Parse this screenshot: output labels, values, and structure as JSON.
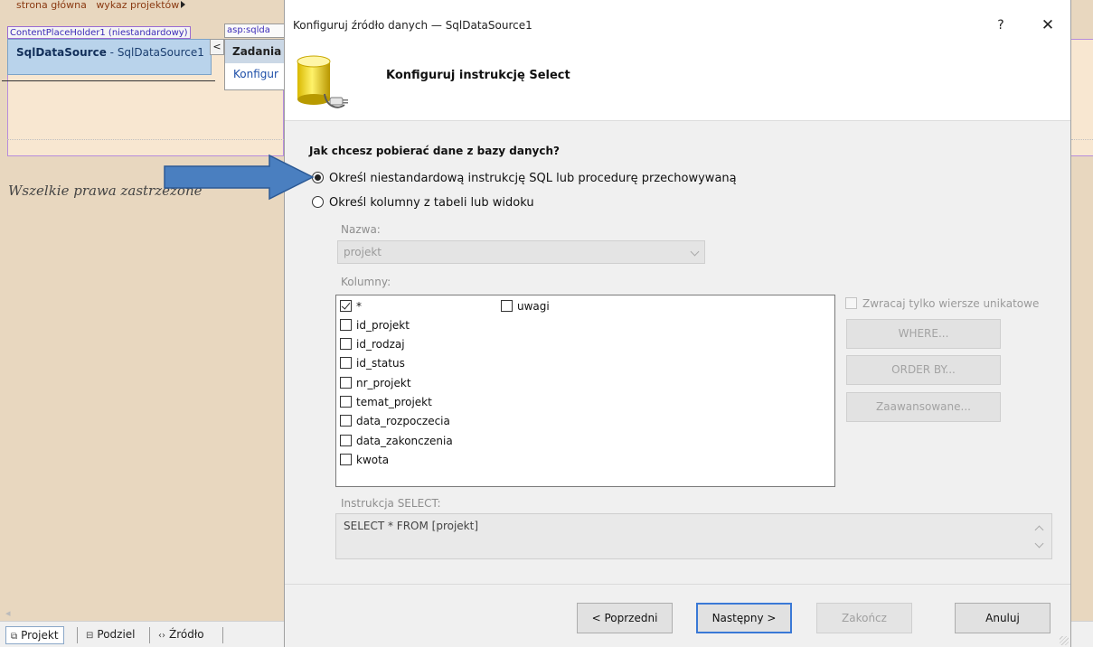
{
  "designer": {
    "breadcrumb_1": "strona główna",
    "breadcrumb_2": "wykaz projektów",
    "placeholder_tag": "ContentPlaceHolder1 (niestandardowy)",
    "control_tag": "asp:sqlda",
    "datasource_type": "SqlDataSource",
    "datasource_sep": " - ",
    "datasource_name": "SqlDataSource1",
    "smart_tag_chevron": "<",
    "tasks_title": "Zadania S",
    "tasks_link": "Konfigur",
    "footer_text": "Wszelkie prawa zastrzeżone"
  },
  "tabs": [
    {
      "label": "Projekt",
      "icon": "design-icon",
      "active": true
    },
    {
      "label": "Podziel",
      "icon": "split-icon",
      "active": false
    },
    {
      "label": "Źródło",
      "icon": "source-icon",
      "active": false
    }
  ],
  "dialog": {
    "title": "Konfiguruj źródło danych — SqlDataSource1",
    "help": "?",
    "close": "✕",
    "header_title": "Konfiguruj instrukcję Select",
    "question": "Jak chcesz pobierać dane z bazy danych?",
    "options": [
      {
        "label": "Określ niestandardową instrukcję SQL lub procedurę przechowywaną",
        "selected": true
      },
      {
        "label": "Określ kolumny z tabeli lub widoku",
        "selected": false
      }
    ],
    "name_label": "Nazwa:",
    "name_value": "projekt",
    "columns_label": "Kolumny:",
    "columns": [
      {
        "label": "*",
        "checked": true
      },
      {
        "label": "id_projekt",
        "checked": false
      },
      {
        "label": "id_rodzaj",
        "checked": false
      },
      {
        "label": "id_status",
        "checked": false
      },
      {
        "label": "nr_projekt",
        "checked": false
      },
      {
        "label": "temat_projekt",
        "checked": false
      },
      {
        "label": "data_rozpoczecia",
        "checked": false
      },
      {
        "label": "data_zakonczenia",
        "checked": false
      },
      {
        "label": "kwota",
        "checked": false
      },
      {
        "label": "uwagi",
        "checked": false
      }
    ],
    "unique_label": "Zwracaj tylko wiersze unikatowe",
    "where_btn": "WHERE...",
    "orderby_btn": "ORDER BY...",
    "advanced_btn": "Zaawansowane...",
    "select_label": "Instrukcja SELECT:",
    "select_statement": "SELECT * FROM [projekt]",
    "buttons": {
      "prev": "< Poprzedni",
      "next": "Następny >",
      "finish": "Zakończ",
      "cancel": "Anuluj"
    }
  },
  "colors": {
    "designer_bg": "#e8d7bf",
    "dialog_bg": "#f0f0f0",
    "callout_arrow": "#4a7fc0",
    "primary_button_border": "#3a79d6"
  }
}
